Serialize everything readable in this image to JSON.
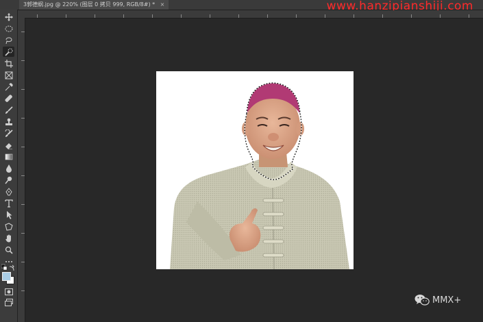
{
  "tab": {
    "title": "3郭德纲.jpg @ 220% (图层 0 拷贝 999, RGB/8#) *",
    "close": "×"
  },
  "watermark": "www.hanzipianshiji.com",
  "toolbar": {
    "tools": [
      "move-icon",
      "marquee-icon",
      "lasso-icon",
      "quick-selection-icon",
      "crop-icon",
      "frame-icon",
      "eyedropper-icon",
      "healing-brush-icon",
      "brush-icon",
      "clone-stamp-icon",
      "history-brush-icon",
      "eraser-icon",
      "gradient-icon",
      "blur-icon",
      "dodge-icon",
      "pen-icon",
      "type-icon",
      "path-selection-icon",
      "shape-icon",
      "hand-icon",
      "zoom-icon",
      "more-tools-icon"
    ],
    "foreground_color": "#a9cde6",
    "background_color": "#ffffff"
  },
  "brand": {
    "icon": "wechat-icon",
    "label": "MMX+"
  }
}
